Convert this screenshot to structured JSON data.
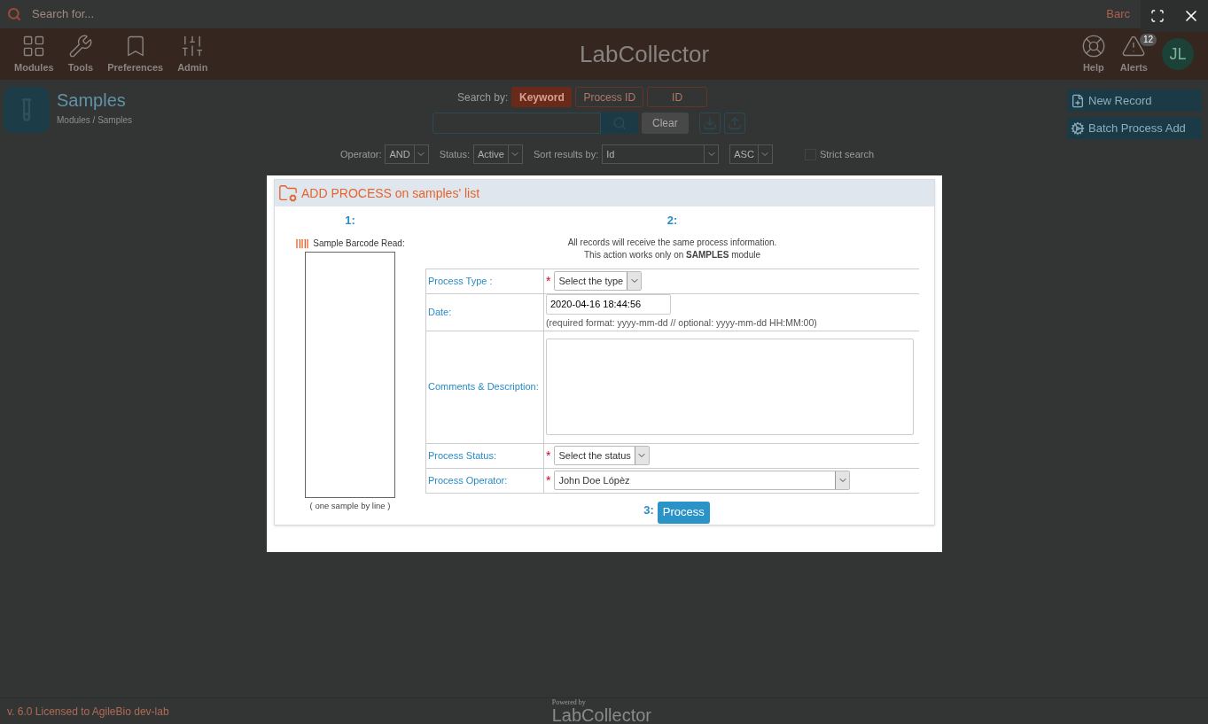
{
  "search_bar": {
    "placeholder": "Search for...",
    "right_text": "Barc"
  },
  "nav": {
    "items": [
      {
        "label": "Modules"
      },
      {
        "label": "Tools"
      },
      {
        "label": "Preferences"
      },
      {
        "label": "Admin"
      }
    ],
    "logo": "LabCollector",
    "right_items": [
      {
        "label": "Help"
      },
      {
        "label": "Alerts",
        "badge": "12"
      }
    ],
    "avatar": "JL"
  },
  "page": {
    "title": "Samples",
    "breadcrumb": "Modules / Samples",
    "search_by_label": "Search by:",
    "search_by": [
      {
        "label": "Keyword",
        "selected": true
      },
      {
        "label": "Process ID",
        "selected": false
      },
      {
        "label": "ID",
        "selected": false
      }
    ],
    "clear_button": "Clear",
    "actions": [
      {
        "label": "New Record"
      },
      {
        "label": "Batch Process Add"
      }
    ],
    "filters": [
      {
        "label": "Operator:",
        "value": "AND"
      },
      {
        "label": "Status:",
        "value": "Active"
      },
      {
        "label": "Sort results by:",
        "value": "Id"
      },
      {
        "value": "ASC"
      }
    ],
    "strict_search": {
      "label": "Strict search",
      "checked": false
    }
  },
  "modal": {
    "title": "ADD PROCESS on samples' list",
    "step1": "1:",
    "barcode_label": "Sample Barcode Read:",
    "barcode_hint": "( one sample by line )",
    "step2": "2:",
    "info": [
      "All records will receive the same process information.",
      "This action works only on **SAMPLES** module"
    ],
    "fields": [
      {
        "kind": "select",
        "label": "Process Type :",
        "required_mark": "*",
        "value": "Select the type"
      },
      {
        "kind": "date",
        "label": "Date:",
        "value": "2020-04-16 18:44:56",
        "hint": "(required format: yyyy-mm-dd // optional: yyyy-mm-dd HH:MM:00)"
      },
      {
        "kind": "textarea",
        "label": "Comments & Description:"
      },
      {
        "kind": "select",
        "label": "Process Status:",
        "required_mark": "*",
        "value": "Select the status"
      },
      {
        "kind": "long_select",
        "label": "Process Operator:",
        "required_mark": "*",
        "value": "John Doe Lópèz"
      }
    ],
    "step3": "3:",
    "submit": "Process"
  },
  "footer": {
    "version": "v. 6.0 Licensed to AgileBio dev-lab",
    "powered_by": "Powered by",
    "logo": "LabCollector"
  }
}
